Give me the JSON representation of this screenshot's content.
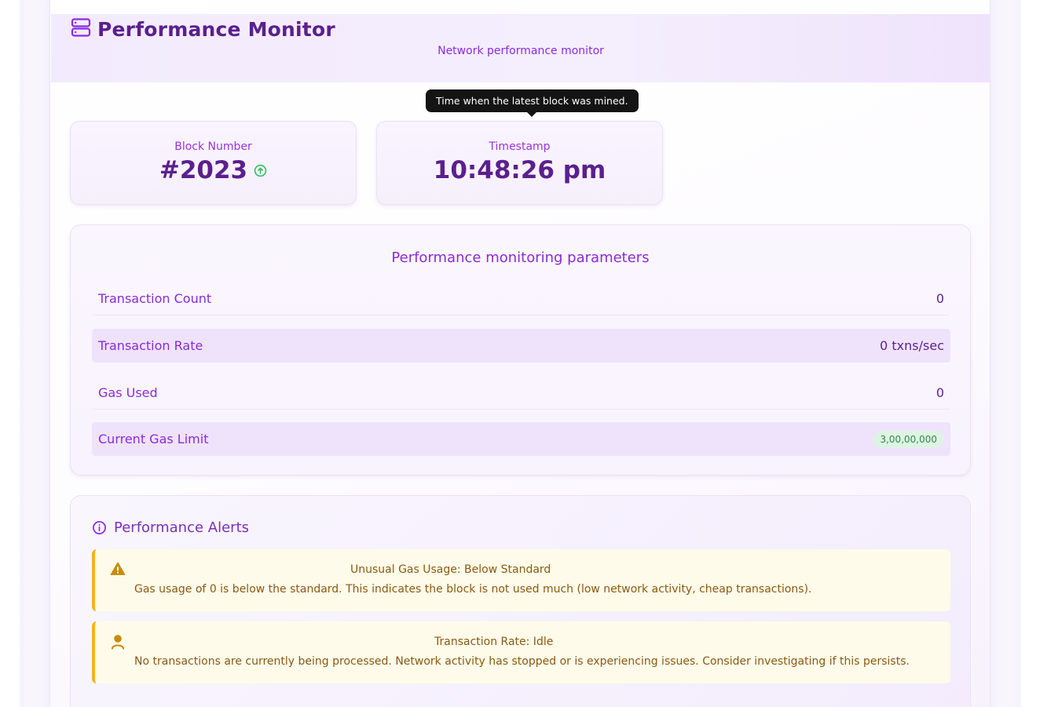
{
  "header": {
    "title": "Performance Monitor",
    "subtitle": "Network performance monitor",
    "icon": "server-icon"
  },
  "tooltip": {
    "text": "Time when the latest block was mined."
  },
  "stats": {
    "block_label": "Block Number",
    "block_value": "#2023",
    "block_trend_icon": "arrow-up-circle-icon",
    "timestamp_label": "Timestamp",
    "timestamp_value": "10:48:26 pm"
  },
  "params": {
    "title": "Performance monitoring parameters",
    "rows": [
      {
        "label": "Transaction Count",
        "value": "0"
      },
      {
        "label": "Transaction Rate",
        "value": "0 txns/sec"
      },
      {
        "label": "Gas Used",
        "value": "0"
      },
      {
        "label": "Current Gas Limit",
        "value": "3,00,00,000"
      }
    ]
  },
  "alerts": {
    "title": "Performance Alerts",
    "icon": "info-circle-icon",
    "items": [
      {
        "icon": "warning-triangle-icon",
        "title": "Unusual Gas Usage: Below Standard",
        "text": "Gas usage of 0 is below the standard. This indicates the block is not used much (low network activity, cheap transactions)."
      },
      {
        "icon": "user-icon",
        "title": "Transaction Rate: Idle",
        "text": "No transactions are currently being processed. Network activity has stopped or is experiencing issues. Consider investigating if this persists."
      }
    ]
  },
  "colors": {
    "primary": "#5b1f8e",
    "accent": "#8a2bd6",
    "alert_border": "#f1b41b",
    "alert_bg": "#fefbea",
    "badge_green": "#2e8b4a"
  }
}
